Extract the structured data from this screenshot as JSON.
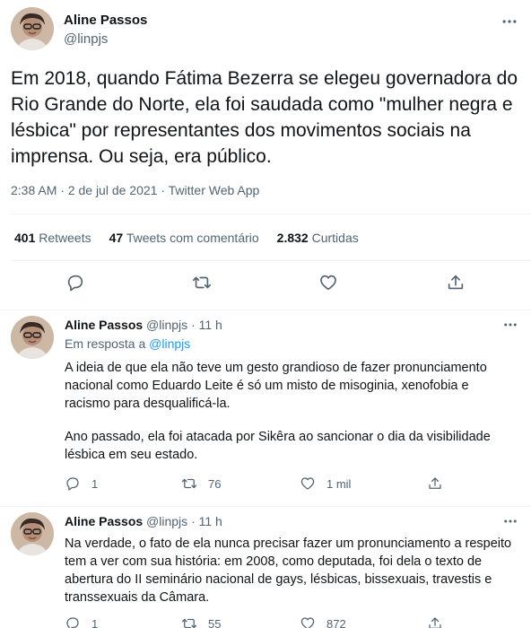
{
  "main_tweet": {
    "author_name": "Aline Passos",
    "author_handle": "@linpjs",
    "text": "Em 2018, quando Fátima Bezerra se elegeu governadora do Rio Grande do Norte, ela foi saudada como \"mulher negra e lésbica\" por representantes dos movimentos sociais na imprensa. Ou seja, era público.",
    "meta": "2:38 AM · 2 de jul de 2021 · Twitter Web App",
    "stats": {
      "retweets_count": "401",
      "retweets_label": "Retweets",
      "quotes_count": "47",
      "quotes_label": "Tweets com comentário",
      "likes_count": "2.832",
      "likes_label": "Curtidas"
    }
  },
  "replies": [
    {
      "author_name": "Aline Passos",
      "author_handle": "@linpjs",
      "time": "· 11 h",
      "in_reply_prefix": "Em resposta a",
      "in_reply_handle": "@linpjs",
      "paragraph_1": "A ideia de que ela não teve um gesto grandioso de fazer pronunciamento nacional como Eduardo Leite é só um misto de misoginia, xenofobia e racismo para desqualificá-la.",
      "paragraph_2": "Ano passado, ela foi atacada por Sikêra ao sancionar o dia da visibilidade lésbica em seu estado.",
      "reply_count": "1",
      "retweet_count": "76",
      "like_count": "1 mil"
    },
    {
      "author_name": "Aline Passos",
      "author_handle": "@linpjs",
      "time": "· 11 h",
      "paragraph_1": "Na verdade, o fato de ela nunca precisar fazer um pronunciamento a respeito tem a ver com sua história: em 2008, como deputada, foi dela o texto de abertura do II seminário nacional de gays, lésbicas, bissexuais, travestis e transsexuais da Câmara.",
      "reply_count": "1",
      "retweet_count": "55",
      "like_count": "872"
    }
  ],
  "icons": {
    "reply": "reply-icon",
    "retweet": "retweet-icon",
    "like": "heart-icon",
    "share": "share-icon",
    "more": "more-icon"
  },
  "colors": {
    "link": "#1d9bf0",
    "secondary_text": "#536471",
    "primary_text": "#0f1419"
  }
}
